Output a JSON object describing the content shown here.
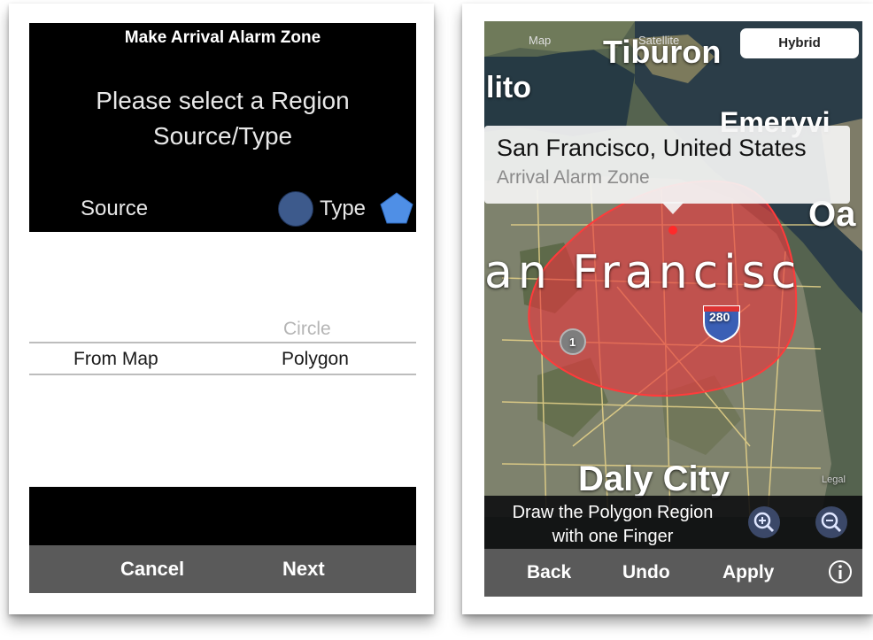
{
  "left_screen": {
    "title": "Make Arrival Alarm Zone",
    "prompt_line1": "Please select a Region",
    "prompt_line2": "Source/Type",
    "source_label": "Source",
    "type_label": "Type",
    "source_icon": "circle-icon",
    "type_icon": "pentagon-icon",
    "picker": {
      "source_options": [
        "From Map"
      ],
      "type_options": [
        "Circle",
        "Polygon"
      ],
      "selected_source": "From Map",
      "selected_type": "Polygon"
    },
    "toolbar": {
      "cancel_label": "Cancel",
      "next_label": "Next"
    },
    "colors": {
      "header_bg": "#000000",
      "toolbar_bg": "#5a5a5a",
      "icon_blue": "#3d5a8c",
      "pentagon_blue": "#4f8fe6"
    }
  },
  "right_screen": {
    "map_type_segment": {
      "options": [
        "Map",
        "Satellite",
        "Hybrid"
      ],
      "selected": "Hybrid"
    },
    "map_labels": {
      "tiburon": "Tiburon",
      "lito": "lito",
      "emery": "Emeryvi",
      "oa": "Oa",
      "san_francisco": "an Francisc",
      "daly_city": "Daly City",
      "legal": "Legal",
      "highway": "280",
      "cluster": "1"
    },
    "callout": {
      "title": "San Francisco, United States",
      "subtitle": "Arrival Alarm Zone"
    },
    "instruction_line1": "Draw the Polygon Region",
    "instruction_line2": "with one Finger",
    "zoom_buttons": [
      "zoom-in-icon",
      "zoom-out-icon"
    ],
    "toolbar": {
      "back_label": "Back",
      "undo_label": "Undo",
      "apply_label": "Apply",
      "info_icon": "info-icon"
    },
    "colors": {
      "zone_fill": "#e8353b",
      "zone_stroke": "#ff3b3b",
      "toolbar_bg": "#5a5a5a"
    }
  }
}
